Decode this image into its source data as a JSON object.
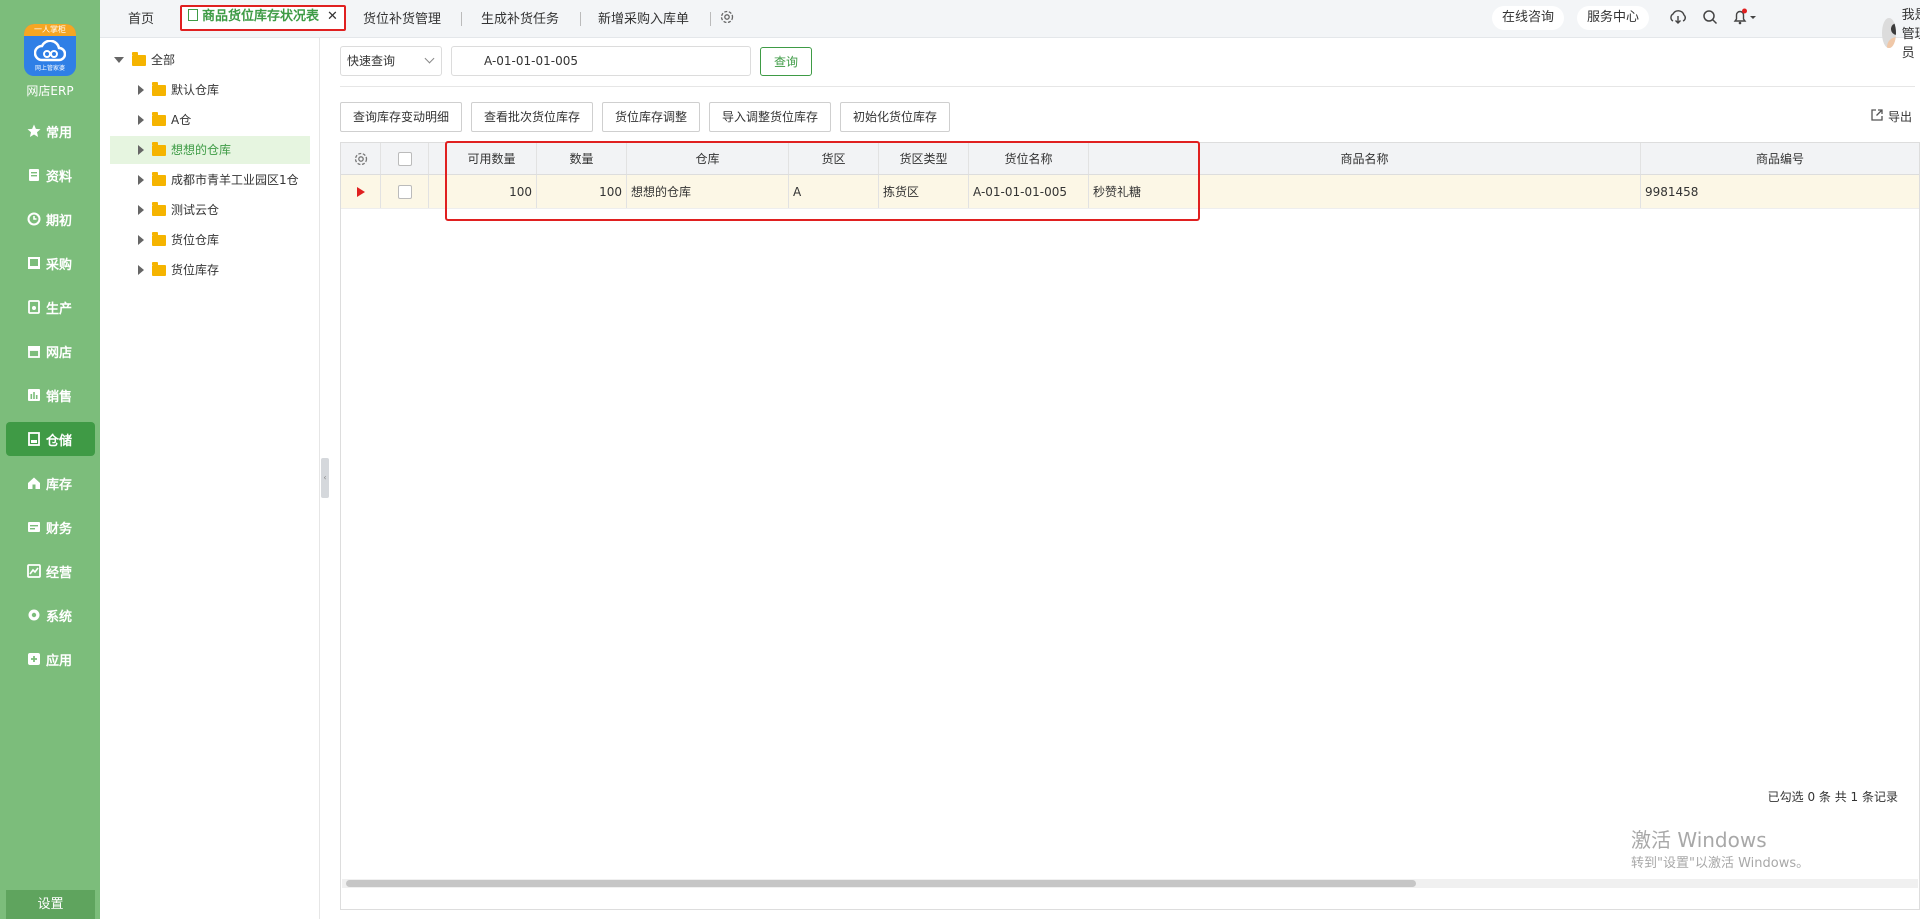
{
  "app": {
    "logo_top": "一人掌柜",
    "logo_sub": "网上管家婆",
    "name": "网店ERP",
    "settings": "设置"
  },
  "nav": [
    {
      "label": "常用",
      "icon": "star-icon"
    },
    {
      "label": "资料",
      "icon": "document-icon"
    },
    {
      "label": "期初",
      "icon": "clock-icon"
    },
    {
      "label": "采购",
      "icon": "purchase-icon"
    },
    {
      "label": "生产",
      "icon": "production-icon"
    },
    {
      "label": "网店",
      "icon": "shop-icon"
    },
    {
      "label": "销售",
      "icon": "sales-chart-icon"
    },
    {
      "label": "仓储",
      "icon": "warehouse-icon",
      "active": true
    },
    {
      "label": "库存",
      "icon": "home-icon"
    },
    {
      "label": "财务",
      "icon": "finance-icon"
    },
    {
      "label": "经营",
      "icon": "business-chart-icon"
    },
    {
      "label": "系统",
      "icon": "gear-icon"
    },
    {
      "label": "应用",
      "icon": "plus-box-icon"
    }
  ],
  "tabs": {
    "home": "首页",
    "active": "商品货位库存状况表",
    "t2": "货位补货管理",
    "t3": "生成补货任务",
    "t4": "新增采购入库单"
  },
  "header": {
    "consult": "在线咨询",
    "service": "服务中心",
    "user": "我是管理员"
  },
  "tree": {
    "root": "全部",
    "items": [
      "默认仓库",
      "A仓",
      "想想的仓库",
      "成都市青羊工业园区1仓",
      "测试云仓",
      "货位仓库",
      "货位库存"
    ]
  },
  "search": {
    "mode": "快速查询",
    "value": "A-01-01-01-005",
    "button": "查询"
  },
  "toolbar": {
    "b1": "查询库存变动明细",
    "b2": "查看批次货位库存",
    "b3": "货位库存调整",
    "b4": "导入调整货位库存",
    "b5": "初始化货位库存",
    "export": "导出"
  },
  "table": {
    "headers": {
      "available": "可用数量",
      "qty": "数量",
      "warehouse": "仓库",
      "area": "货区",
      "area_type": "货区类型",
      "location": "货位名称",
      "product_name": "商品名称",
      "product_code": "商品编号"
    },
    "rows": [
      {
        "available": "100",
        "qty": "100",
        "warehouse": "想想的仓库",
        "area": "A",
        "area_type": "拣货区",
        "location": "A-01-01-01-005",
        "product_name": "秒赞礼糖",
        "product_code": "9981458"
      }
    ],
    "footer": "已勾选 0 条 共 1 条记录"
  },
  "watermark": {
    "line1": "激活 Windows",
    "line2": "转到\"设置\"以激活 Windows。"
  },
  "colors": {
    "nav_bg": "#7cbd7b",
    "nav_active": "#3f9a45",
    "accent": "#3e9b45",
    "highlight": "#e02020",
    "row_bg": "#fcf7e6"
  }
}
